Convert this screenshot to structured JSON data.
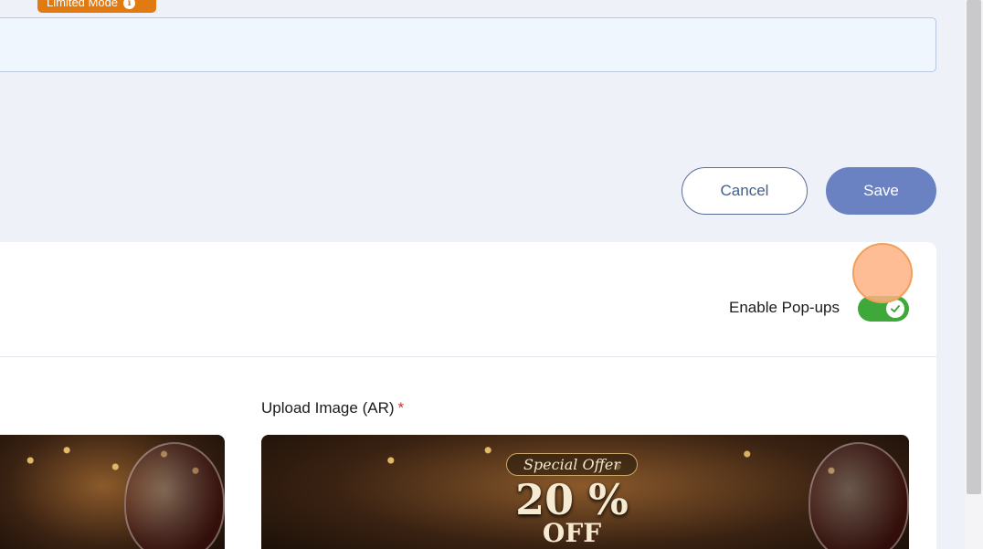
{
  "header": {
    "badge_label": "Limited Mode",
    "badge_icon": "info-icon"
  },
  "form": {
    "text_field_value": ""
  },
  "actions": {
    "cancel_label": "Cancel",
    "save_label": "Save"
  },
  "popups": {
    "toggle_label": "Enable Pop-ups",
    "enabled": true,
    "toggle_icon": "check-icon",
    "toggle_color": "#3ea83a"
  },
  "upload": {
    "ar_label": "Upload Image (AR)",
    "required_mark": "*",
    "ar_image": {
      "special_text": "Special Offer",
      "discount_text": "20 % ",
      "off_text": "OFF"
    }
  },
  "colors": {
    "badge": "#e27a12",
    "save_button": "#6b82c2",
    "cancel_border": "#5b6f98",
    "background": "#eef1f8"
  }
}
